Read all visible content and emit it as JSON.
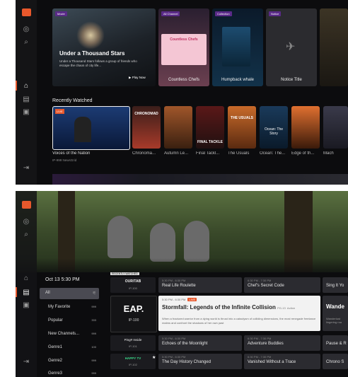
{
  "hero": {
    "tag": "Movie",
    "title": "Under a Thousand Stars",
    "desc": "Under a Thousand Stars follows a group of friends who escape the chaos of city life...",
    "play": "Play Now"
  },
  "cards": [
    {
      "tag": "All Channel",
      "title": "Countless Chefs",
      "art": "Countless Chefs"
    },
    {
      "tag": "Collection",
      "title": "Humpback whale"
    },
    {
      "tag": "Notice",
      "title": "Notice Title"
    }
  ],
  "recent": {
    "heading": "Recently Watched",
    "items": [
      {
        "label": "Voices of the Nation",
        "sub": "IP-999 NewsGrid",
        "art": "LIVE"
      },
      {
        "label": "Chronoma...",
        "art": "CHRONOMAD"
      },
      {
        "label": "Autumn Le..."
      },
      {
        "label": "Final Tackl...",
        "art": "FINAL TACKLE"
      },
      {
        "label": "The Usuals",
        "art": "THE USUALS"
      },
      {
        "label": "Ocean: The...",
        "art": "Ocean: The Story"
      },
      {
        "label": "Edge of th..."
      },
      {
        "label": "Mach"
      }
    ]
  },
  "guide": {
    "date": "Oct 13 5:30 PM",
    "categories": [
      {
        "name": "All",
        "count": ""
      },
      {
        "name": "My Favorite",
        "count": "999"
      },
      {
        "name": "Popular",
        "count": "333"
      },
      {
        "name": "New Channels...",
        "count": "999"
      },
      {
        "name": "Genre1",
        "count": "100"
      },
      {
        "name": "Genre2",
        "count": "999"
      },
      {
        "name": "Genre3",
        "count": "999"
      }
    ],
    "recently_watched_tag": "RECENTLY WATCHED",
    "channels": [
      {
        "logo": "OUR/TAB",
        "num": "IP-100"
      },
      {
        "logo": "EAP.",
        "num": "IP-100"
      },
      {
        "logo": "Ping# Inside",
        "num": "IP-101"
      },
      {
        "logo": "HAPPY TV",
        "num": "IP-102"
      }
    ],
    "programs": [
      {
        "time": "5:30 PM - 6:30 PM",
        "title": "Real Life Roulette"
      },
      {
        "time": "6:30 PM - 7:30 PM",
        "title": "Chef's Secret Code"
      },
      {
        "time": "",
        "title": "Sing It Yo"
      },
      {
        "time": "5:30 PM - 6:30 PM",
        "badge": "LIVE",
        "title": "Stormfall: Legends of the Infinite Collision",
        "rating": "PG-13",
        "genre": "Action",
        "desc": "When a fractured warrior from a dying world is thrust into a cataclysm of colliding dimensions, the most renegade freelance realms and confront the shadows of her own past"
      },
      {
        "time": "",
        "title": "Wande",
        "desc": "Wanderlust lingering roa"
      },
      {
        "time": "5:30 PM - 6:30 PM",
        "title": "Echoes of the Moonlight"
      },
      {
        "time": "6:30 PM - 7:30 PM",
        "title": "Adventure Buddies"
      },
      {
        "time": "",
        "title": "Pause & R"
      },
      {
        "time": "5:30 PM - 6:30 PM",
        "title": "The Day History Changed"
      },
      {
        "time": "6:30 PM - 7:30 PM",
        "title": "Vanished Without a Trace"
      },
      {
        "time": "",
        "title": "Chrono S"
      }
    ]
  },
  "colors": {
    "accent": "#e8582c",
    "tag": "#5a2a88",
    "live": "#e8582c"
  }
}
